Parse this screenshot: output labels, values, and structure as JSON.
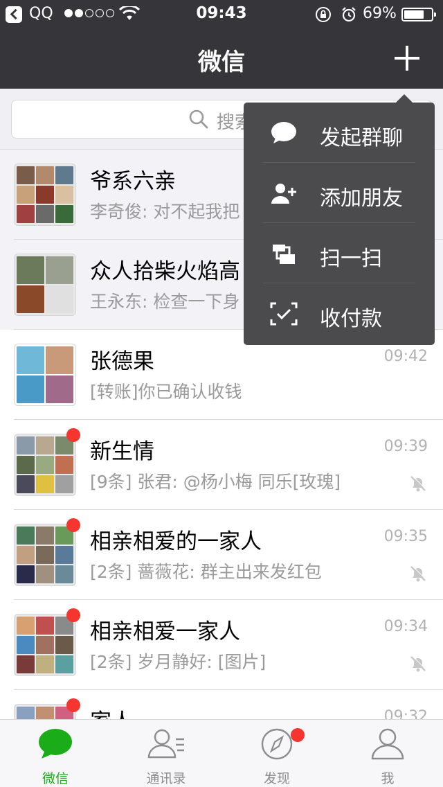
{
  "status_bar": {
    "back_app": "QQ",
    "time": "09:43",
    "battery": "69%"
  },
  "nav": {
    "title": "微信"
  },
  "search": {
    "placeholder": "搜索"
  },
  "chats": [
    {
      "name": "爷系六亲",
      "message": "李奇俊: 对不起我把",
      "time": "",
      "unread_dot": false,
      "muted": false,
      "pinned": true
    },
    {
      "name": "众人拾柴火焰高",
      "message": "王永东: 检查一下身",
      "time": "",
      "unread_dot": false,
      "muted": false,
      "pinned": true
    },
    {
      "name": "张德果",
      "message": "[转账]你已确认收钱",
      "time": "09:42",
      "unread_dot": false,
      "muted": false,
      "pinned": false
    },
    {
      "name": "新生情",
      "message": "[9条] 张君: @杨小梅 同乐[玫瑰]",
      "time": "09:39",
      "unread_dot": true,
      "muted": true,
      "pinned": false
    },
    {
      "name": "相亲相爱的一家人",
      "message": "[2条] 蔷薇花: 群主出来发红包",
      "time": "09:35",
      "unread_dot": true,
      "muted": true,
      "pinned": false
    },
    {
      "name": "相亲相爱一家人",
      "message": "[2条] 岁月静好: [图片]",
      "time": "09:34",
      "unread_dot": true,
      "muted": true,
      "pinned": false
    },
    {
      "name": "家人",
      "message": "",
      "time": "09:32",
      "unread_dot": true,
      "muted": false,
      "pinned": false
    }
  ],
  "popup_menu": [
    {
      "label": "发起群聊",
      "icon": "chat-bubble-icon"
    },
    {
      "label": "添加朋友",
      "icon": "add-friend-icon"
    },
    {
      "label": "扫一扫",
      "icon": "scan-icon"
    },
    {
      "label": "收付款",
      "icon": "payment-icon"
    }
  ],
  "tabs": [
    {
      "label": "微信",
      "active": true
    },
    {
      "label": "通讯录",
      "active": false
    },
    {
      "label": "发现",
      "active": false,
      "badge": true
    },
    {
      "label": "我",
      "active": false
    }
  ],
  "colors": {
    "nav_bg": "#36363a",
    "accent_green": "#1aad19",
    "badge_red": "#f43530",
    "popup_bg": "#4b4b4d"
  }
}
